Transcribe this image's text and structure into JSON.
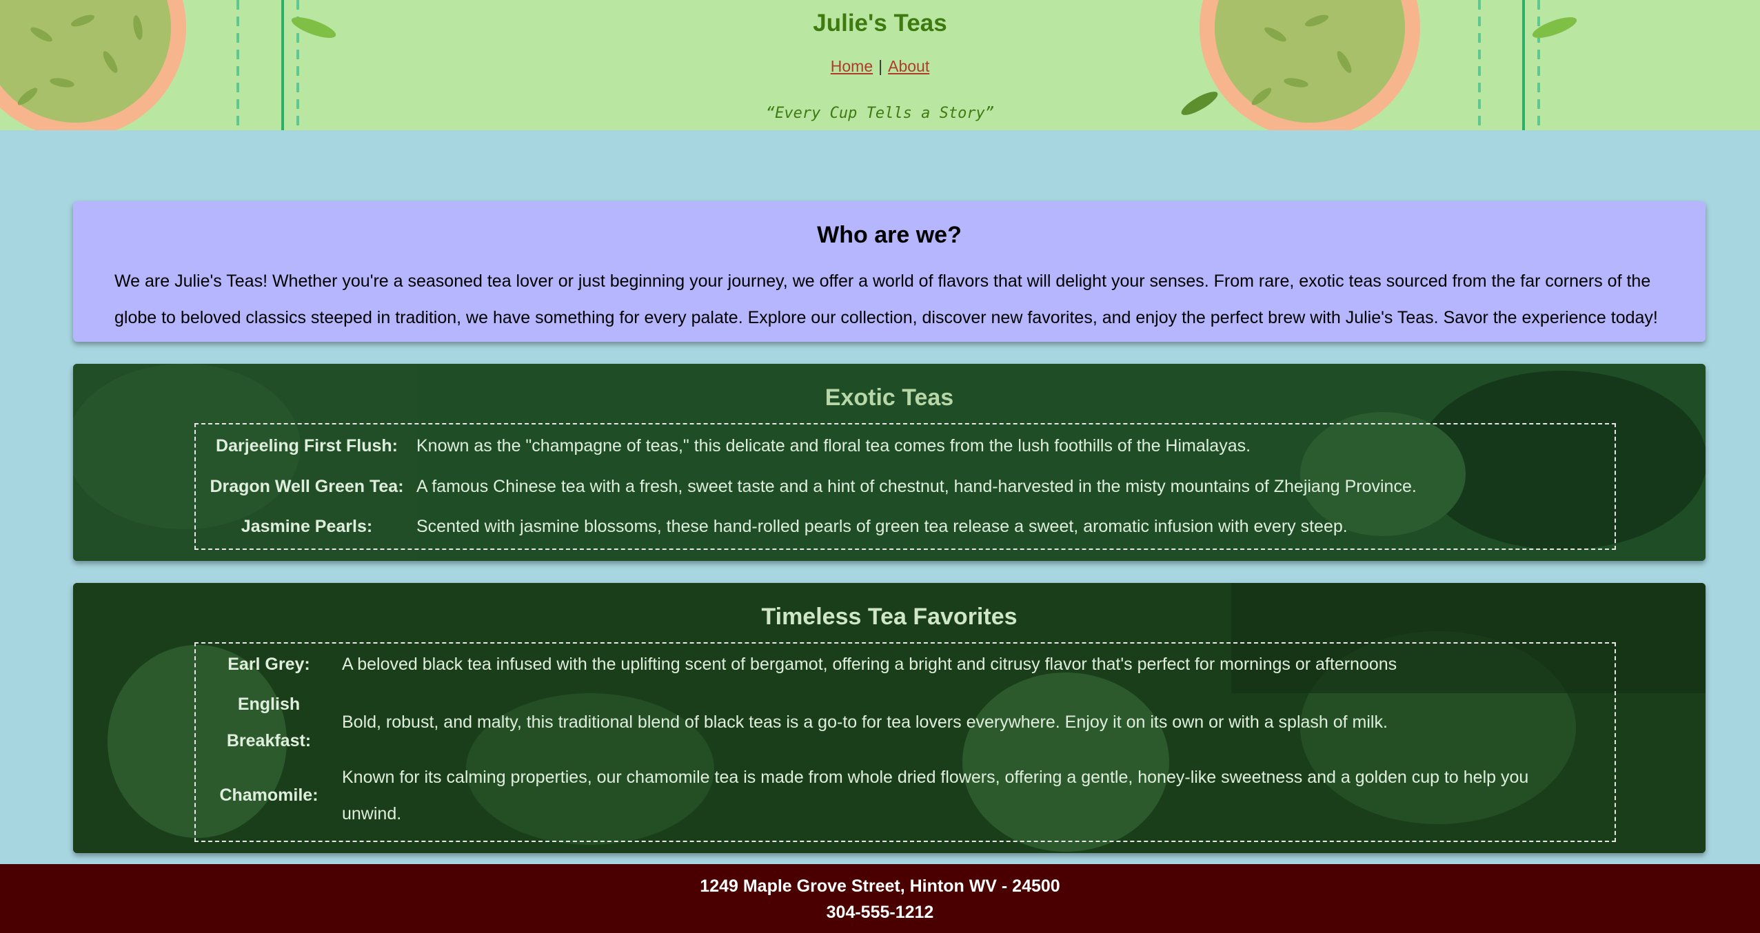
{
  "header": {
    "title": "Julie's Teas",
    "nav": {
      "home": "Home",
      "separator": "|",
      "about": "About"
    },
    "tagline": "“Every Cup Tells a Story”"
  },
  "about": {
    "heading": "Who are we?",
    "text": "We are Julie's Teas! Whether you're a seasoned tea lover or just beginning your journey, we offer a world of flavors that will delight your senses. From rare, exotic teas sourced from the far corners of the globe to beloved classics steeped in tradition, we have something for every palate. Explore our collection, discover new favorites, and enjoy the perfect brew with Julie's Teas. Savor the experience today!"
  },
  "exotic": {
    "heading": "Exotic Teas",
    "teas": [
      {
        "name": "Darjeeling First Flush:",
        "desc": "Known as the \"champagne of teas,\" this delicate and floral tea comes from the lush foothills of the Himalayas."
      },
      {
        "name": "Dragon Well Green Tea:",
        "desc": "A famous Chinese tea with a fresh, sweet taste and a hint of chestnut, hand-harvested in the misty mountains of Zhejiang Province."
      },
      {
        "name": "Jasmine Pearls:",
        "desc": "Scented with jasmine blossoms, these hand-rolled pearls of green tea release a sweet, aromatic infusion with every steep."
      }
    ]
  },
  "timeless": {
    "heading": "Timeless Tea Favorites",
    "teas": [
      {
        "name": "Earl Grey:",
        "desc": "A beloved black tea infused with the uplifting scent of bergamot, offering a bright and citrusy flavor that's perfect for mornings or afternoons"
      },
      {
        "name": "English Breakfast:",
        "desc": "Bold, robust, and malty, this traditional blend of black teas is a go-to for tea lovers everywhere. Enjoy it on its own or with a splash of milk."
      },
      {
        "name": "Chamomile:",
        "desc": "Known for its calming properties, our chamomile tea is made from whole dried flowers, offering a gentle, honey-like sweetness and a golden cup to help you unwind."
      }
    ]
  },
  "footer": {
    "address": "1249 Maple Grove Street, Hinton WV - 24500",
    "phone": "304-555-1212"
  },
  "colors": {
    "header_bg": "#b9e7a2",
    "page_bg": "#a8d6e0",
    "about_bg": "#b6b6fe",
    "card_green": "#1f4d26",
    "footer_bg": "#4b0000",
    "title_green": "#3f7a11",
    "link_red": "#b03a2e"
  }
}
